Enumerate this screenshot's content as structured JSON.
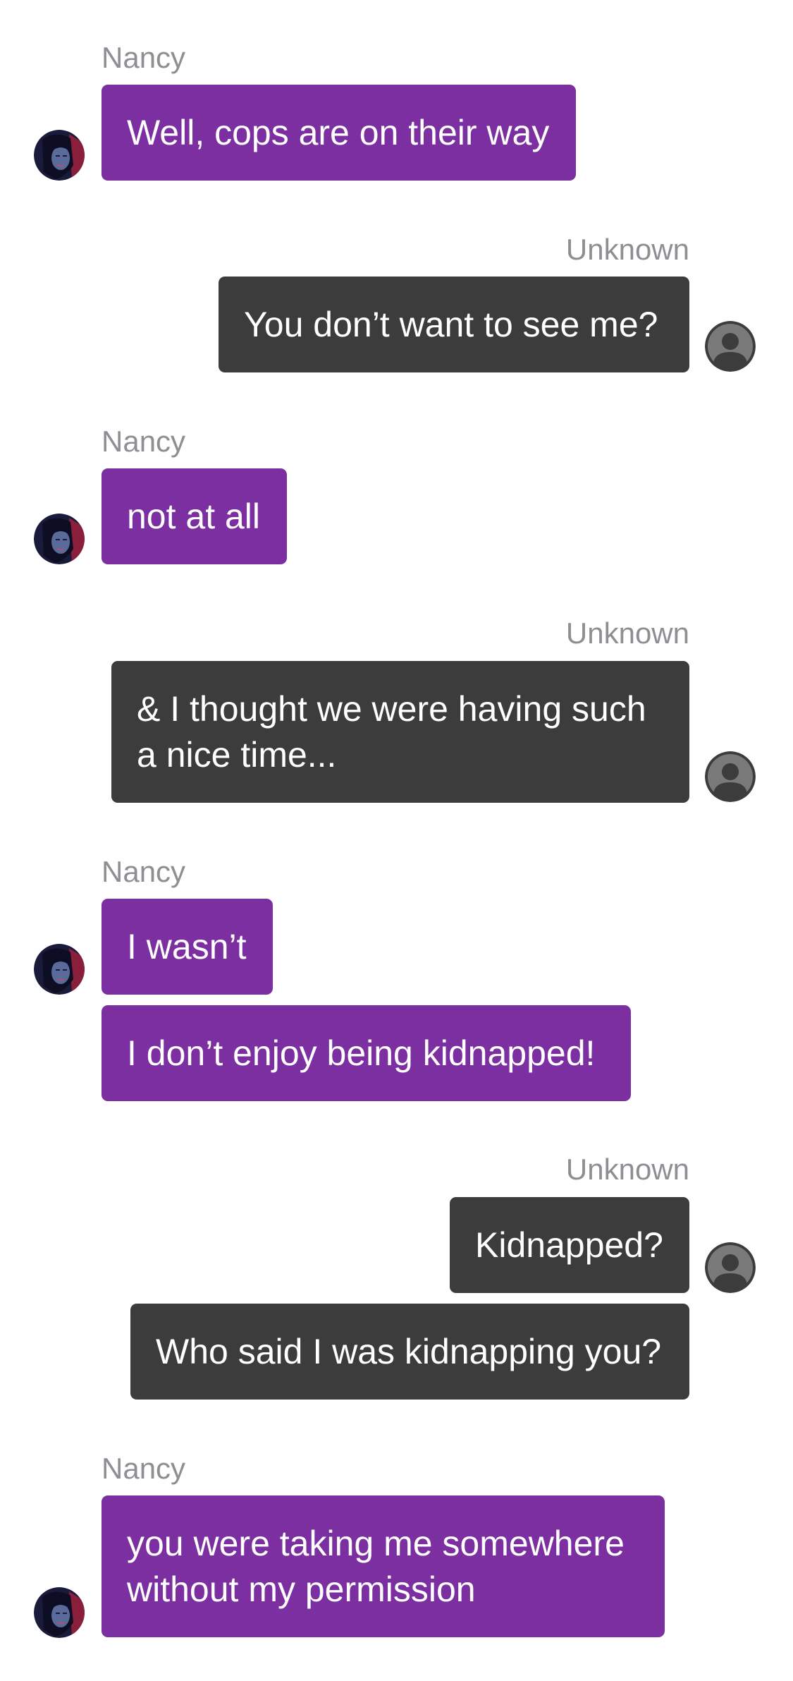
{
  "conversation": {
    "messages": [
      {
        "sender": "Nancy",
        "text": "Well, cops are on their way"
      },
      {
        "sender": "Unknown",
        "text": "You don’t want to see me?"
      },
      {
        "sender": "Nancy",
        "text": "not at all"
      },
      {
        "sender": "Unknown",
        "text": "& I thought we were having such\na nice time..."
      },
      {
        "sender": "Nancy",
        "text": "I wasn’t"
      },
      {
        "sender": "Nancy",
        "text": "I don’t enjoy being kidnapped!"
      },
      {
        "sender": "Unknown",
        "text": "Kidnapped?"
      },
      {
        "sender": "Unknown",
        "text": "Who said I was kidnapping you?"
      },
      {
        "sender": "Nancy",
        "text": "you were taking me somewhere\nwithout my permission"
      }
    ],
    "sender_labels": {
      "group1": "Nancy",
      "group2": "Unknown",
      "group3": "Nancy",
      "group4": "Unknown",
      "group5": "Nancy",
      "group6": "Unknown",
      "group7": "Nancy"
    }
  },
  "colors": {
    "nancy_bubble": "#7b2fa0",
    "unknown_bubble": "#3c3c3c",
    "sender_label": "#8e8e93",
    "background": "#ffffff"
  },
  "icons": {
    "nancy_avatar": "nancy-portrait-avatar",
    "unknown_avatar": "default-person-avatar"
  }
}
